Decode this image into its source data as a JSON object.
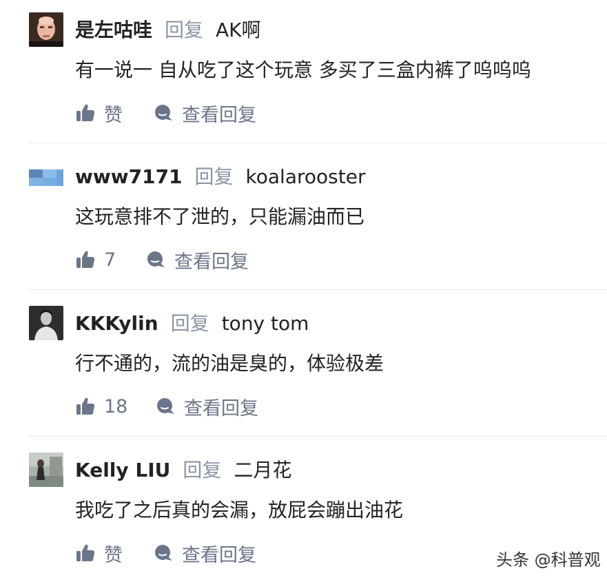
{
  "comments": [
    {
      "username": "是左咕哇",
      "reply_label": "回复",
      "reply_to": "AK啊",
      "text": "有一说一 自从吃了这个玩意 多买了三盒内裤了呜呜呜",
      "like_label": "赞",
      "view_replies_label": "查看回复"
    },
    {
      "username": "www7171",
      "reply_label": "回复",
      "reply_to": "koalarooster",
      "text": "这玩意排不了泄的，只能漏油而已",
      "like_label": "7",
      "view_replies_label": "查看回复"
    },
    {
      "username": "KKKylin",
      "reply_label": "回复",
      "reply_to": "tony tom",
      "text": "行不通的，流的油是臭的，体验极差",
      "like_label": "18",
      "view_replies_label": "查看回复"
    },
    {
      "username": "Kelly LIU",
      "reply_label": "回复",
      "reply_to": "二月花",
      "text": "我吃了之后真的会漏，放屁会蹦出油花",
      "like_label": "赞",
      "view_replies_label": "查看回复"
    }
  ],
  "watermark": "头条 @科普观",
  "colors": {
    "primary_text": "#222222",
    "secondary_text": "#8a94a6",
    "action_text": "#6b7588",
    "divider": "#ececec"
  }
}
